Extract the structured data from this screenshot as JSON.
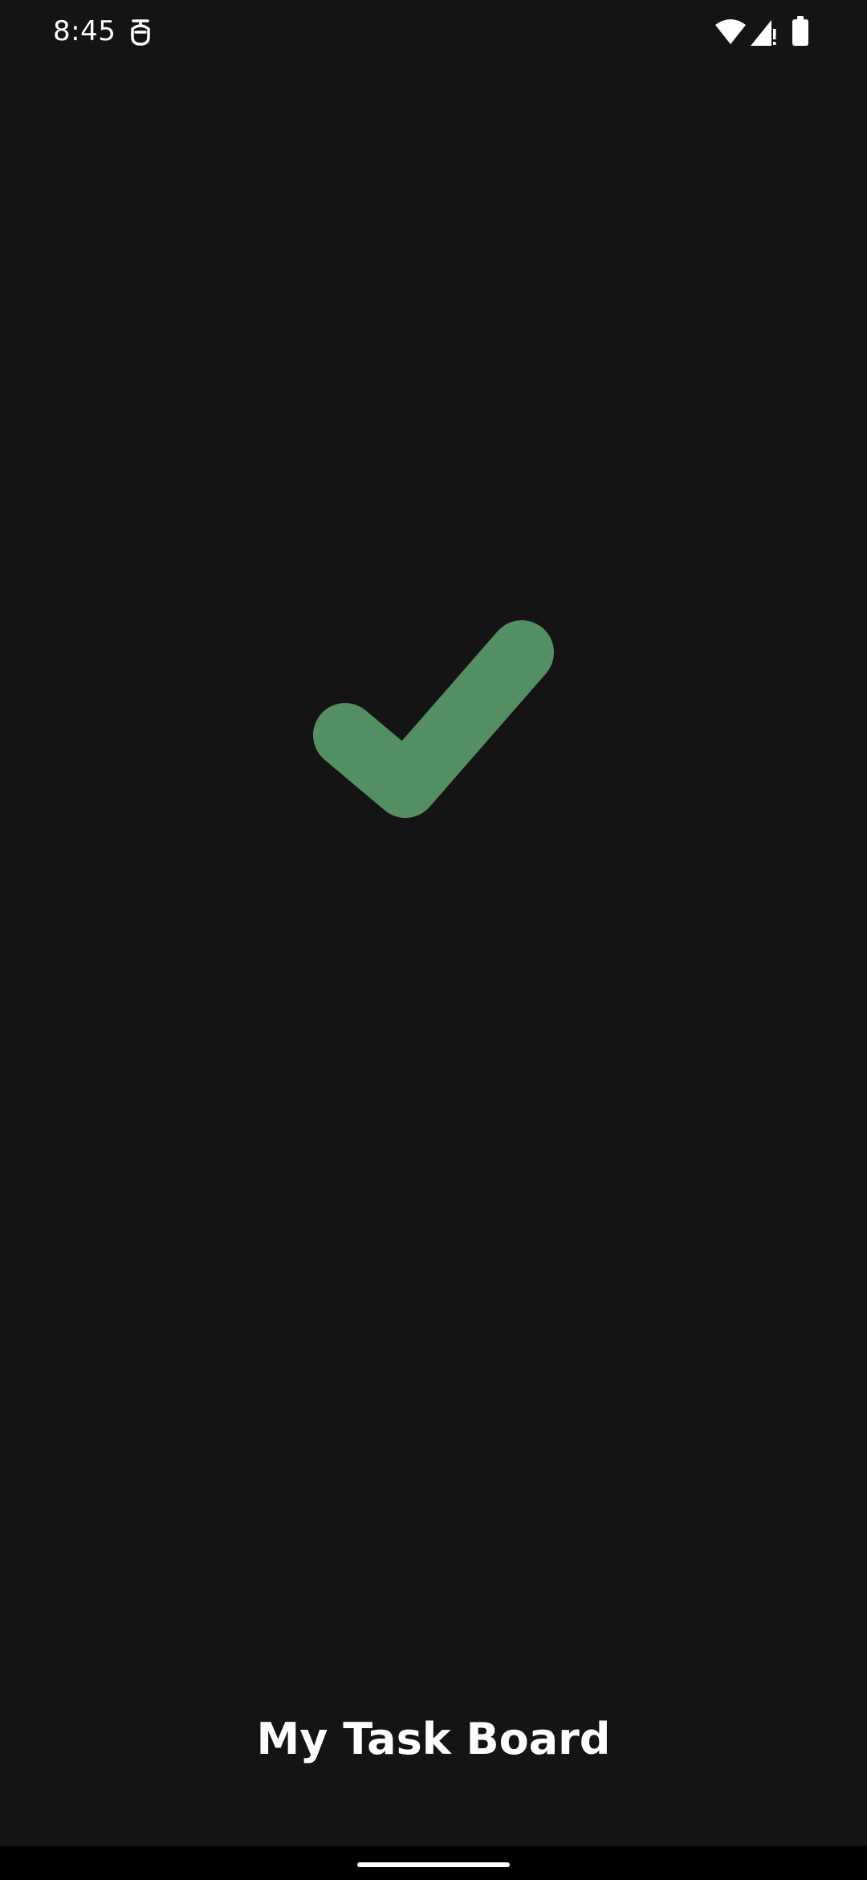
{
  "status_bar": {
    "time": "8:45",
    "icons": [
      "notification-app-icon",
      "wifi-icon",
      "cellular-signal-icon",
      "battery-icon"
    ]
  },
  "splash": {
    "logo_icon": "checkmark-icon",
    "logo_color": "#538f62",
    "app_name": "My Task Board"
  },
  "theme": {
    "background": "#141414",
    "text": "#ffffff"
  }
}
